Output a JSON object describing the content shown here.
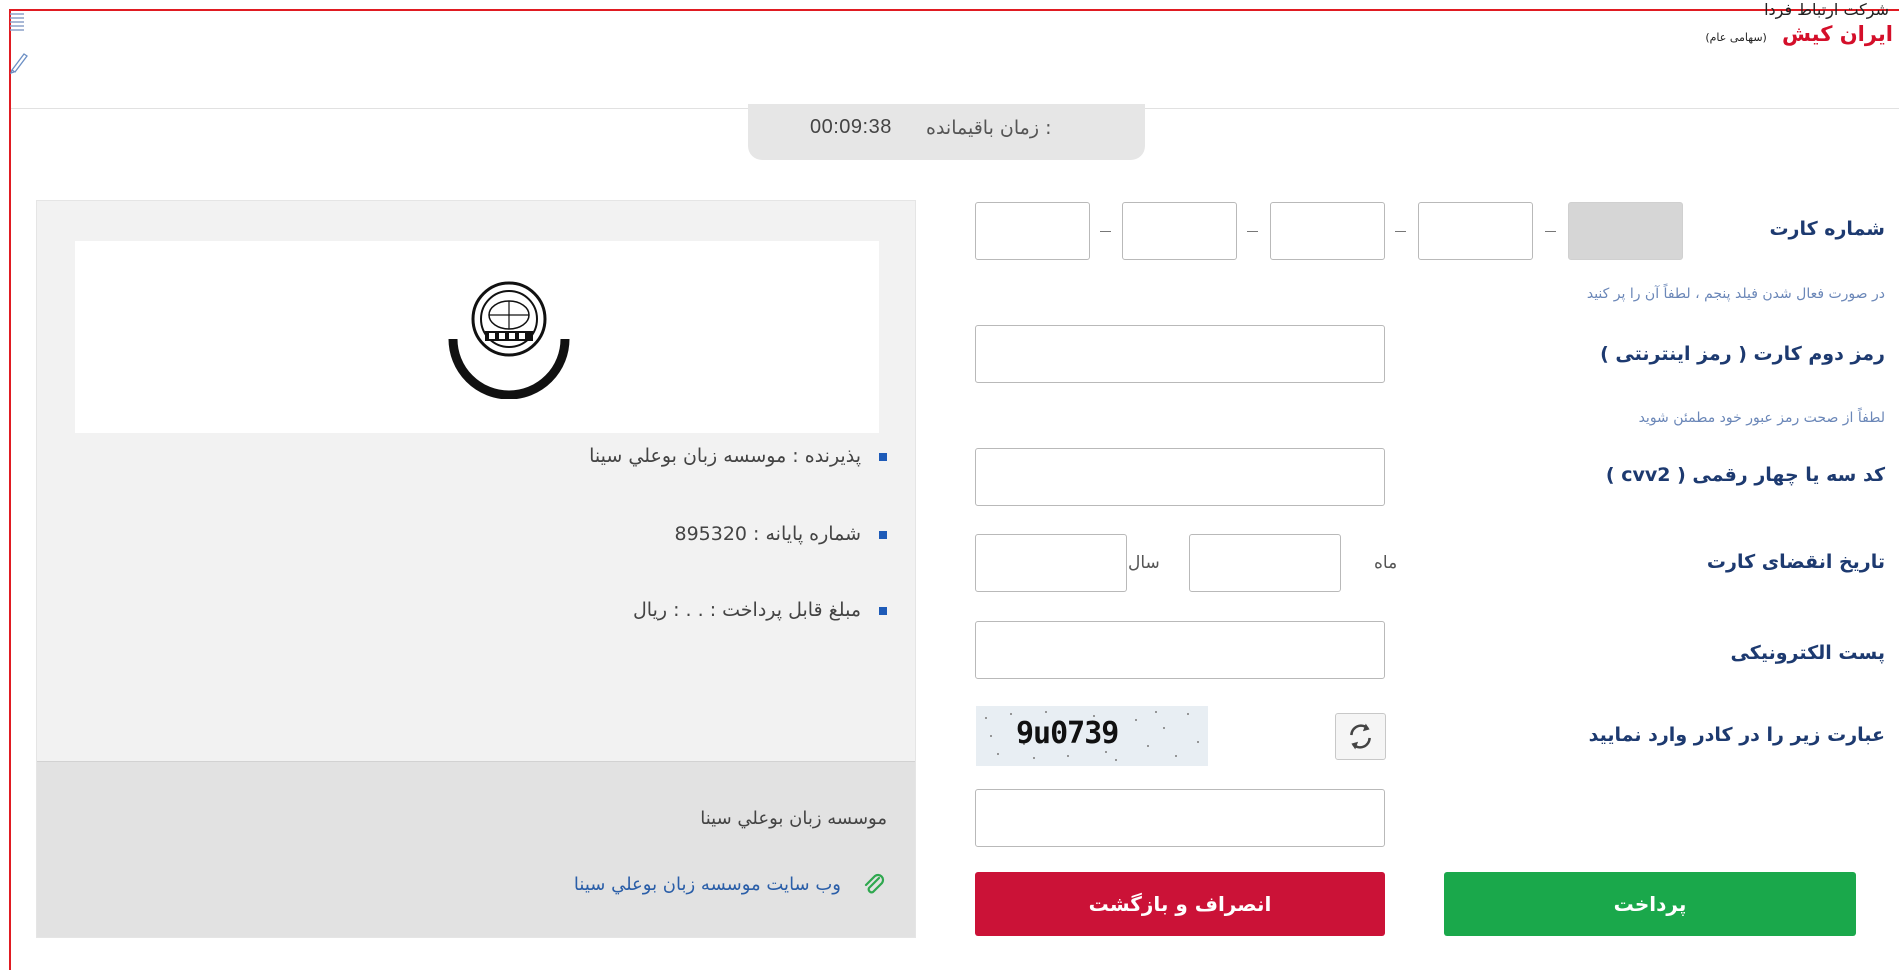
{
  "header": {
    "bank_top_text": "شرکت ارتباط فردا",
    "bank_name": "ایران کیش",
    "bank_type": "(سهامی عام)"
  },
  "timer": {
    "label": "زمان باقیمانده :",
    "value": "00:09:38"
  },
  "merchant": {
    "acceptor": "پذیرنده : موسسه زبان بوعلي سينا",
    "terminal": "شماره پایانه : 895320",
    "amount": "مبلغ قابل پرداخت :   .  .  :     ریال",
    "footer_name": "موسسه زبان بوعلي سينا",
    "website_link": "وب سایت موسسه زبان بوعلي سينا"
  },
  "form": {
    "card_number_label": "شماره کارت",
    "fifth_field_hint": "در صورت فعال شدن فیلد پنجم ، لطفاً آن را پر کنید",
    "pin2_label": "رمز دوم کارت ( رمز اینترنتی )",
    "pin2_hint": "لطفاً از صحت رمز عبور خود مطمئن شوید",
    "cvv2_label": "کد سه یا چهار رقمی ( cvv2 )",
    "expiry_label": "تاریخ انقضای کارت",
    "month_label": "ماه",
    "year_label": "سال",
    "email_label": "پست الکترونیکی",
    "captcha_label": "عبارت زیر را در کادر وارد نمایید",
    "captcha_text": "9u0739"
  },
  "buttons": {
    "cancel": "انصراف و بازگشت",
    "pay": "پرداخت"
  },
  "colors": {
    "brand_red": "#d40f2a",
    "pay_green": "#1aa84b",
    "cancel_red": "#cb1237",
    "label_blue": "#1d3a70"
  }
}
